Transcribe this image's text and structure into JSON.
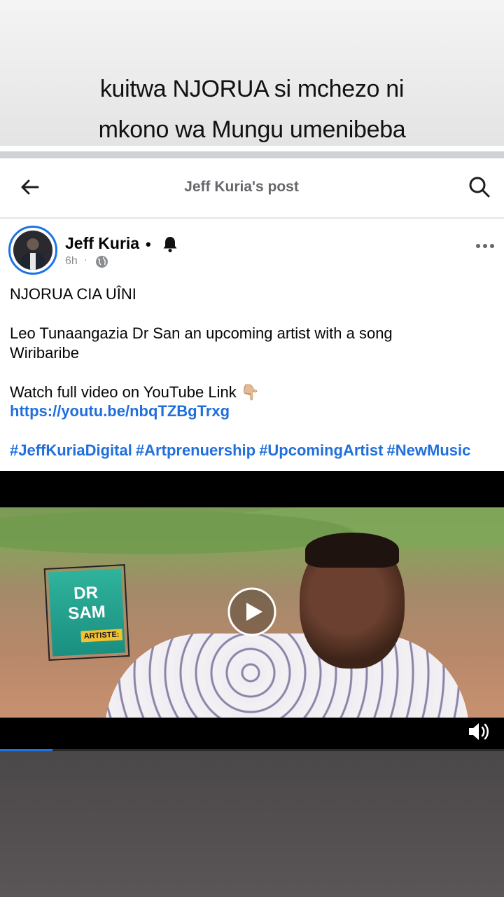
{
  "caption": {
    "line1": "kuitwa NJORUA si mchezo ni",
    "line2": "mkono wa Mungu umenibeba"
  },
  "header": {
    "title": "Jeff Kuria's post",
    "back_icon": "arrow-left-icon",
    "search_icon": "search-icon"
  },
  "post": {
    "author": "Jeff Kuria",
    "dot": "•",
    "time": "6h",
    "time_sep": "·",
    "privacy_icon": "globe-icon",
    "text1": "NJORUA CIA UÎNI",
    "text2": "Leo Tunaangazia Dr San  an upcoming artist with a song\nWiribaribe",
    "text3": "Watch full video on YouTube Link 👇🏼",
    "link": "https://youtu.be/nbqTZBgTrxg",
    "hashtags": "#JeffKuriaDigital #Artprenuership #UpcomingArtist #NewMusic"
  },
  "video": {
    "badge_line1": "DR",
    "badge_line2": "SAM",
    "badge_tag": "ARTISTE:",
    "progress": 0.104
  },
  "colors": {
    "accent": "#1b74e4",
    "link": "#216fdb",
    "header_text": "#65676b"
  }
}
